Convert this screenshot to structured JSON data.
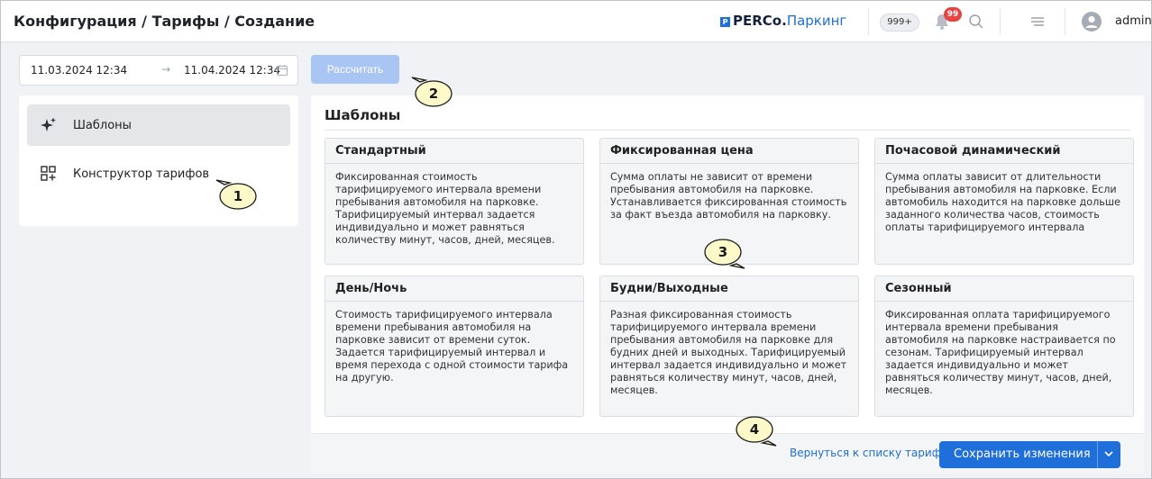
{
  "header": {
    "breadcrumb": "Конфигурация / Тарифы / Создание",
    "logo_brand": "PERCo.",
    "logo_sub": "Паркинг",
    "count_badge": "999+",
    "notification_count": "99",
    "user_name": "admin"
  },
  "date_range": {
    "from": "11.03.2024 12:34",
    "to": "11.04.2024 12:34",
    "arrow": "→"
  },
  "calculate_button": "Рассчитать",
  "sidebar": {
    "items": [
      {
        "label": "Шаблоны",
        "icon": "sparkle-icon",
        "active": true
      },
      {
        "label": "Конструктор тарифов",
        "icon": "grid-plus-icon",
        "active": false
      }
    ]
  },
  "main": {
    "title": "Шаблоны",
    "cards": [
      {
        "title": "Стандартный",
        "text": "Фиксированная стоимость тарифицируемого интервала времени пребывания автомобиля на парковке. Тарифицируемый интервал задается индивидуально и может равняться количеству минут, часов, дней, месяцев."
      },
      {
        "title": "Фиксированная цена",
        "text": "Сумма оплаты не зависит от времени пребывания автомобиля на парковке. Устанавливается фиксированная стоимость за факт въезда автомобиля на парковку."
      },
      {
        "title": "Почасовой динамический",
        "text": "Сумма оплаты зависит от длительности пребывания автомобиля на парковке. Если автомобиль находится на парковке дольше заданного количества часов, стоимость оплаты тарифицируемого интервала"
      },
      {
        "title": "День/Ночь",
        "text": "Стоимость тарифицируемого интервала времени пребывания автомобиля на парковке зависит от времени суток. Задается тарифицируемый интервал и время перехода с одной стоимости тарифа на другую."
      },
      {
        "title": "Будни/Выходные",
        "text": "Разная фиксированная стоимость тарифицируемого интервала времени пребывания автомобиля на парковке для будних дней и выходных. Тарифицируемый интервал задается индивидуально и может равняться количеству минут, часов, дней, месяцев."
      },
      {
        "title": "Сезонный",
        "text": "Фиксированная оплата тарифицируемого интервала времени пребывания автомобиля на парковке настраивается по сезонам. Тарифицируемый интервал задается индивидуально и может равняться количеству минут, часов, дней, месяцев."
      }
    ]
  },
  "footer": {
    "back_link": "Вернуться к списку тарифов",
    "save_button": "Сохранить изменения"
  },
  "callouts": [
    "1",
    "2",
    "3",
    "4"
  ],
  "colors": {
    "accent": "#1e6fd9",
    "accent_disabled": "#a9c5f3",
    "notification": "#e74343",
    "callout_fill": "#fdf9c9"
  }
}
